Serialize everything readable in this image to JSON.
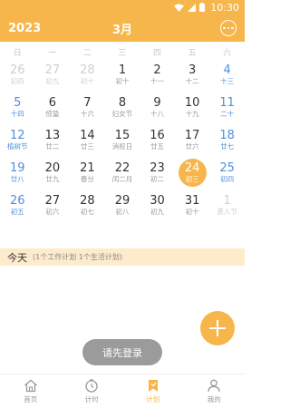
{
  "status": {
    "time": "10:30"
  },
  "header": {
    "year": "2023",
    "month": "3月"
  },
  "weekdays": [
    "日",
    "一",
    "二",
    "三",
    "四",
    "五",
    "六"
  ],
  "weeks": [
    [
      {
        "d": "26",
        "l": "初四",
        "type": "other"
      },
      {
        "d": "27",
        "l": "初九",
        "type": "other"
      },
      {
        "d": "28",
        "l": "初十",
        "type": "other"
      },
      {
        "d": "1",
        "l": "初十",
        "type": "normal"
      },
      {
        "d": "2",
        "l": "十一",
        "type": "normal"
      },
      {
        "d": "3",
        "l": "十二",
        "type": "normal"
      },
      {
        "d": "4",
        "l": "十三",
        "type": "wk"
      }
    ],
    [
      {
        "d": "5",
        "l": "十四",
        "type": "wk"
      },
      {
        "d": "6",
        "l": "惊蛰",
        "type": "normal"
      },
      {
        "d": "7",
        "l": "十六",
        "type": "normal"
      },
      {
        "d": "8",
        "l": "妇女节",
        "type": "normal"
      },
      {
        "d": "9",
        "l": "十八",
        "type": "normal"
      },
      {
        "d": "10",
        "l": "十九",
        "type": "normal"
      },
      {
        "d": "11",
        "l": "二十",
        "type": "wk"
      }
    ],
    [
      {
        "d": "12",
        "l": "植树节",
        "type": "wk"
      },
      {
        "d": "13",
        "l": "廿二",
        "type": "normal"
      },
      {
        "d": "14",
        "l": "廿三",
        "type": "normal"
      },
      {
        "d": "15",
        "l": "消权日",
        "type": "normal"
      },
      {
        "d": "16",
        "l": "廿五",
        "type": "normal"
      },
      {
        "d": "17",
        "l": "廿六",
        "type": "normal"
      },
      {
        "d": "18",
        "l": "廿七",
        "type": "wk"
      }
    ],
    [
      {
        "d": "19",
        "l": "廿八",
        "type": "wk"
      },
      {
        "d": "20",
        "l": "廿九",
        "type": "normal"
      },
      {
        "d": "21",
        "l": "春分",
        "type": "normal"
      },
      {
        "d": "22",
        "l": "闰二月",
        "type": "normal"
      },
      {
        "d": "23",
        "l": "初二",
        "type": "normal"
      },
      {
        "d": "24",
        "l": "初三",
        "type": "today"
      },
      {
        "d": "25",
        "l": "初四",
        "type": "wk"
      }
    ],
    [
      {
        "d": "26",
        "l": "初五",
        "type": "wk"
      },
      {
        "d": "27",
        "l": "初六",
        "type": "normal"
      },
      {
        "d": "28",
        "l": "初七",
        "type": "normal"
      },
      {
        "d": "29",
        "l": "初八",
        "type": "normal"
      },
      {
        "d": "30",
        "l": "初九",
        "type": "normal"
      },
      {
        "d": "31",
        "l": "初十",
        "type": "normal"
      },
      {
        "d": "1",
        "l": "愚人节",
        "type": "other"
      }
    ]
  ],
  "today": {
    "label": "今天",
    "summary": "(1个工作计划 1个生活计划)"
  },
  "toast": "请先登录",
  "tabs": [
    {
      "label": "首页",
      "icon": "home-icon"
    },
    {
      "label": "计时",
      "icon": "timer-icon"
    },
    {
      "label": "计划",
      "icon": "bookmark-icon"
    },
    {
      "label": "我的",
      "icon": "person-icon"
    }
  ],
  "colors": {
    "accent": "#f7b64b",
    "weekend": "#4f8fdc",
    "todayBar": "#fdebcc"
  }
}
